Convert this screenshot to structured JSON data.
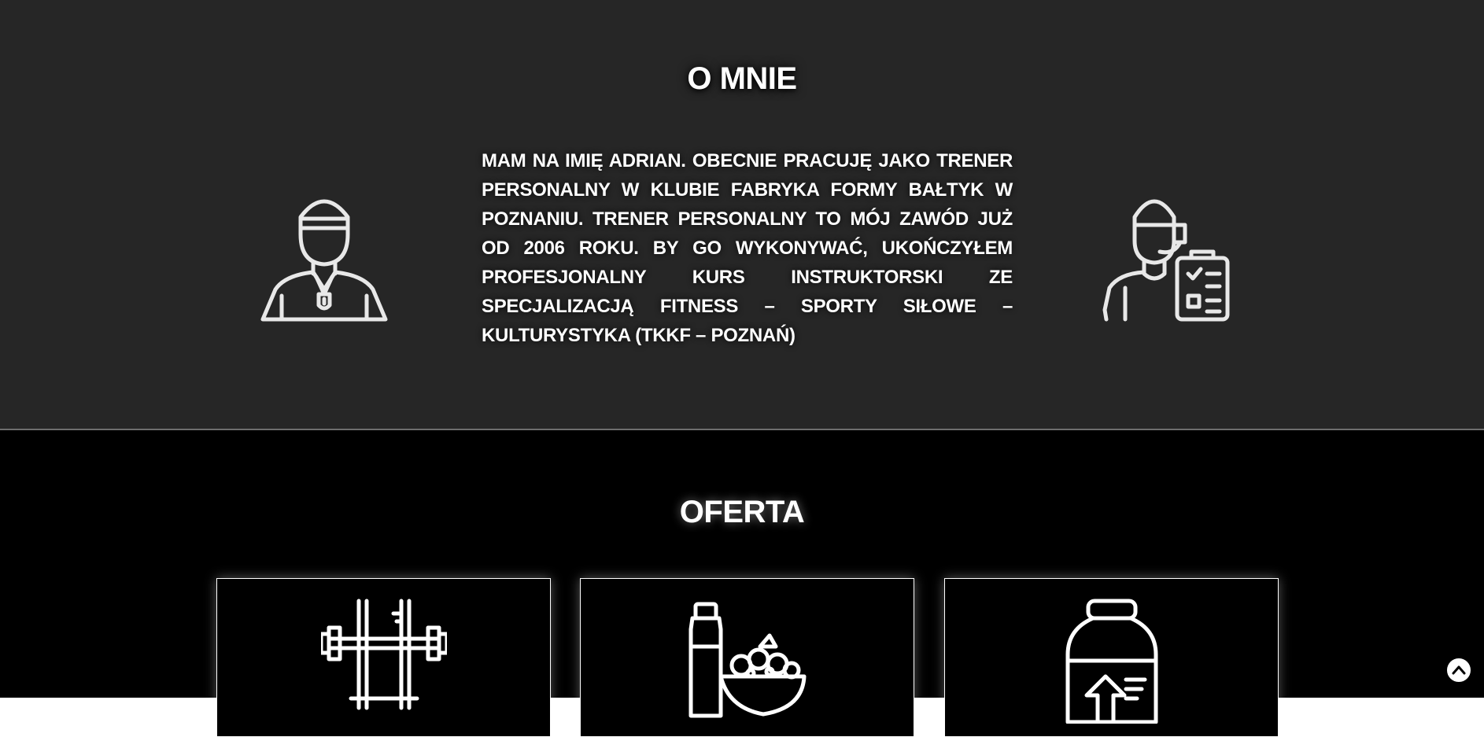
{
  "about": {
    "title": "O MNIE",
    "text": "MAM NA IMIĘ ADRIAN. OBECNIE PRACUJĘ JAKO TRENER PERSONALNY W KLUBIE FABRYKA FORMY BAŁTYK W POZNANIU. TRENER PERSONALNY TO MÓJ ZAWÓD JUŻ OD 2006 ROKU. BY GO WYKONYWAĆ, UKOŃCZYŁEM PROFESJONALNY KURS INSTRUKTORSKI ZE SPECJALIZACJĄ FITNESS – SPORTY SIŁOWE – KULTURYSTYKA (TKKF – POZNAŃ)",
    "left_icon": "coach-whistle-icon",
    "right_icon": "trainer-clipboard-icon"
  },
  "offer": {
    "title": "OFERTA",
    "cards": [
      {
        "icon": "barbell-rack-icon"
      },
      {
        "icon": "diet-food-icon"
      },
      {
        "icon": "supplement-jar-icon"
      }
    ]
  },
  "scroll_top": {
    "icon": "chevron-up-icon"
  },
  "colors": {
    "about_bg": "#262626",
    "offer_bg": "#000000",
    "text": "#ffffff",
    "divider": "#6e6e6e"
  }
}
